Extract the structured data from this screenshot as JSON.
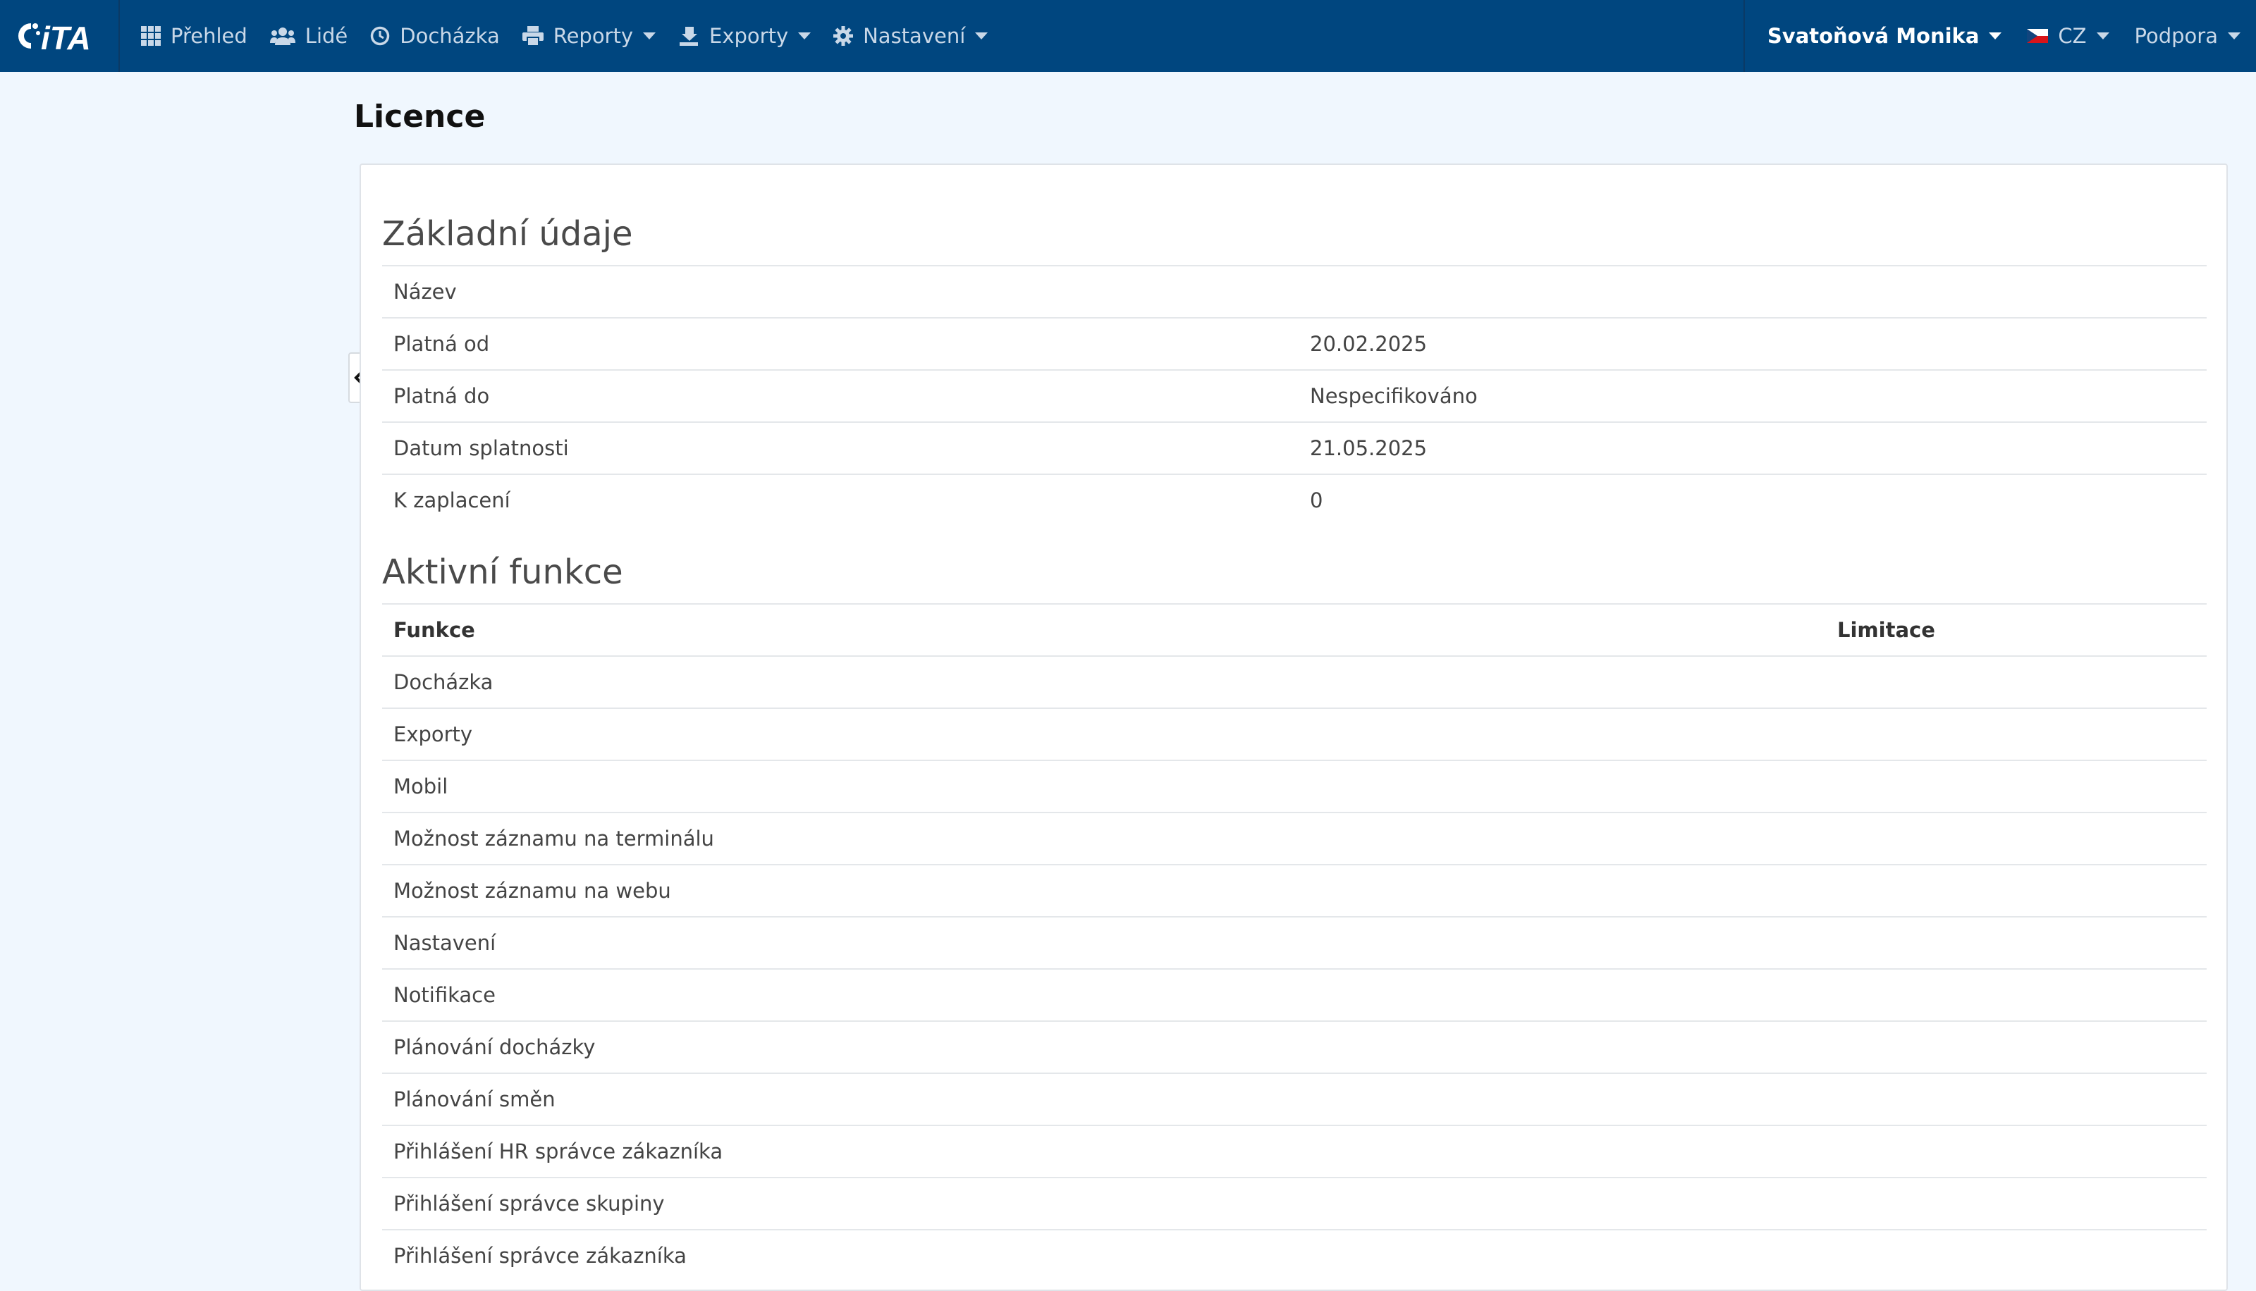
{
  "navbar": {
    "brand": "iTA",
    "items": [
      {
        "label": "Přehled",
        "icon": "grid-icon"
      },
      {
        "label": "Lidé",
        "icon": "users-icon"
      },
      {
        "label": "Docházka",
        "icon": "clock-icon"
      },
      {
        "label": "Reporty",
        "icon": "printer-icon"
      },
      {
        "label": "Exporty",
        "icon": "export-icon"
      },
      {
        "label": "Nastavení",
        "icon": "gear-icon"
      }
    ],
    "user": "Svatoňová Monika",
    "language": "CZ",
    "support": "Podpora"
  },
  "page": {
    "title": "Licence"
  },
  "basic_info": {
    "title": "Základní údaje",
    "rows": [
      {
        "label": "Název",
        "value": ""
      },
      {
        "label": "Platná od",
        "value": "20.02.2025"
      },
      {
        "label": "Platná do",
        "value": "Nespecifikováno"
      },
      {
        "label": "Datum splatnosti",
        "value": "21.05.2025"
      },
      {
        "label": "K zaplacení",
        "value": "0"
      }
    ]
  },
  "features": {
    "title": "Aktivní funkce",
    "columns": [
      "Funkce",
      "Limitace"
    ],
    "rows": [
      {
        "name": "Docházka",
        "limit": ""
      },
      {
        "name": "Exporty",
        "limit": ""
      },
      {
        "name": "Mobil",
        "limit": ""
      },
      {
        "name": "Možnost záznamu na terminálu",
        "limit": ""
      },
      {
        "name": "Možnost záznamu na webu",
        "limit": ""
      },
      {
        "name": "Nastavení",
        "limit": ""
      },
      {
        "name": "Notifikace",
        "limit": ""
      },
      {
        "name": "Plánování docházky",
        "limit": ""
      },
      {
        "name": "Plánování směn",
        "limit": ""
      },
      {
        "name": "Přihlášení HR správce zákazníka",
        "limit": ""
      },
      {
        "name": "Přihlášení správce skupiny",
        "limit": ""
      },
      {
        "name": "Přihlášení správce zákazníka",
        "limit": ""
      }
    ]
  },
  "colors": {
    "navbar": "#00467f",
    "background": "#f0f7fe",
    "panel": "#ffffff"
  }
}
